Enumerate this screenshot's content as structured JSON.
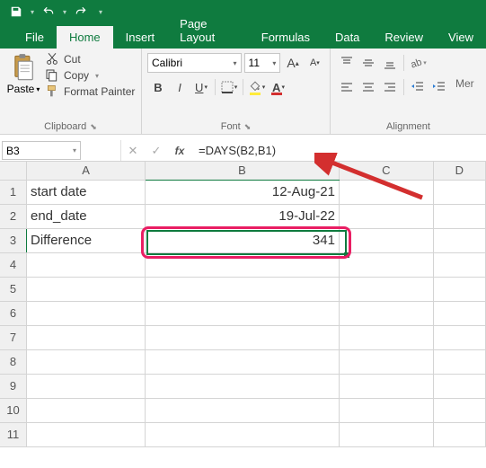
{
  "qat": {
    "save": "save-icon",
    "undo": "undo-icon",
    "redo": "redo-icon"
  },
  "tabs": {
    "file": "File",
    "home": "Home",
    "insert": "Insert",
    "page_layout": "Page Layout",
    "formulas": "Formulas",
    "data": "Data",
    "review": "Review",
    "view": "View"
  },
  "ribbon": {
    "clipboard": {
      "paste": "Paste",
      "cut": "Cut",
      "copy": "Copy",
      "format_painter": "Format Painter",
      "group": "Clipboard"
    },
    "font": {
      "name": "Calibri",
      "size": "11",
      "group": "Font"
    },
    "alignment": {
      "merge": "Mer",
      "group": "Alignment"
    }
  },
  "namebox": "B3",
  "formula": "=DAYS(B2,B1)",
  "columns": [
    "A",
    "B",
    "C",
    "D"
  ],
  "rows": [
    "1",
    "2",
    "3",
    "4",
    "5",
    "6",
    "7",
    "8",
    "9",
    "10",
    "11"
  ],
  "cells": {
    "A1": "start date",
    "B1": "12-Aug-21",
    "A2": "end_date",
    "B2": "19-Jul-22",
    "A3": "Difference",
    "B3": "341"
  }
}
